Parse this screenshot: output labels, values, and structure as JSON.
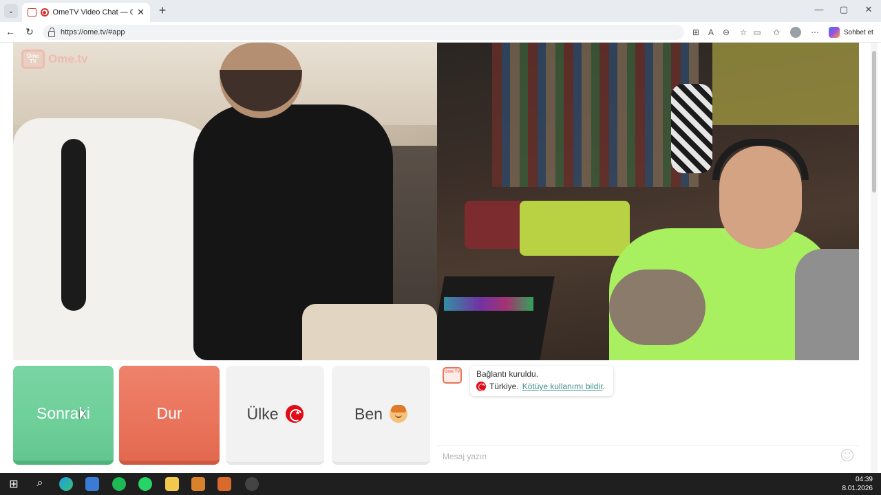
{
  "browser": {
    "tab_title": "OmeTV Video Chat — Omegle",
    "url": "https://ome.tv/#app",
    "copilot_label": "Sohbet et",
    "new_tab": "+",
    "tab_close": "✕"
  },
  "window_controls": {
    "minimize": "—",
    "maximize": "▢",
    "close": "✕"
  },
  "logo": {
    "tv_text": "Ome TV",
    "text": "Ome.tv"
  },
  "buttons": {
    "next": "Sonraki",
    "stop": "Dur",
    "country": "Ülke",
    "me": "Ben"
  },
  "chat": {
    "avatar_text": "Ome TV",
    "line1": "Bağlantı kuruldu.",
    "country": "Türkiye.",
    "report_link": "Kötüye kullanımı bildir",
    "report_suffix": ".",
    "input_placeholder": "Mesaj yazın"
  },
  "taskbar": {
    "time": "04:39",
    "date": "8.01.2026"
  },
  "colors": {
    "next_button": "#6ecf99",
    "stop_button": "#e9735b",
    "link": "#3f8f8c",
    "flag_red": "#e30a17"
  },
  "icons": [
    "back-arrow-icon",
    "reload-icon",
    "lock-icon",
    "star-icon",
    "profile-icon",
    "turkey-flag-icon",
    "boy-emoji-icon",
    "smile-icon",
    "windows-start-icon",
    "search-icon"
  ]
}
